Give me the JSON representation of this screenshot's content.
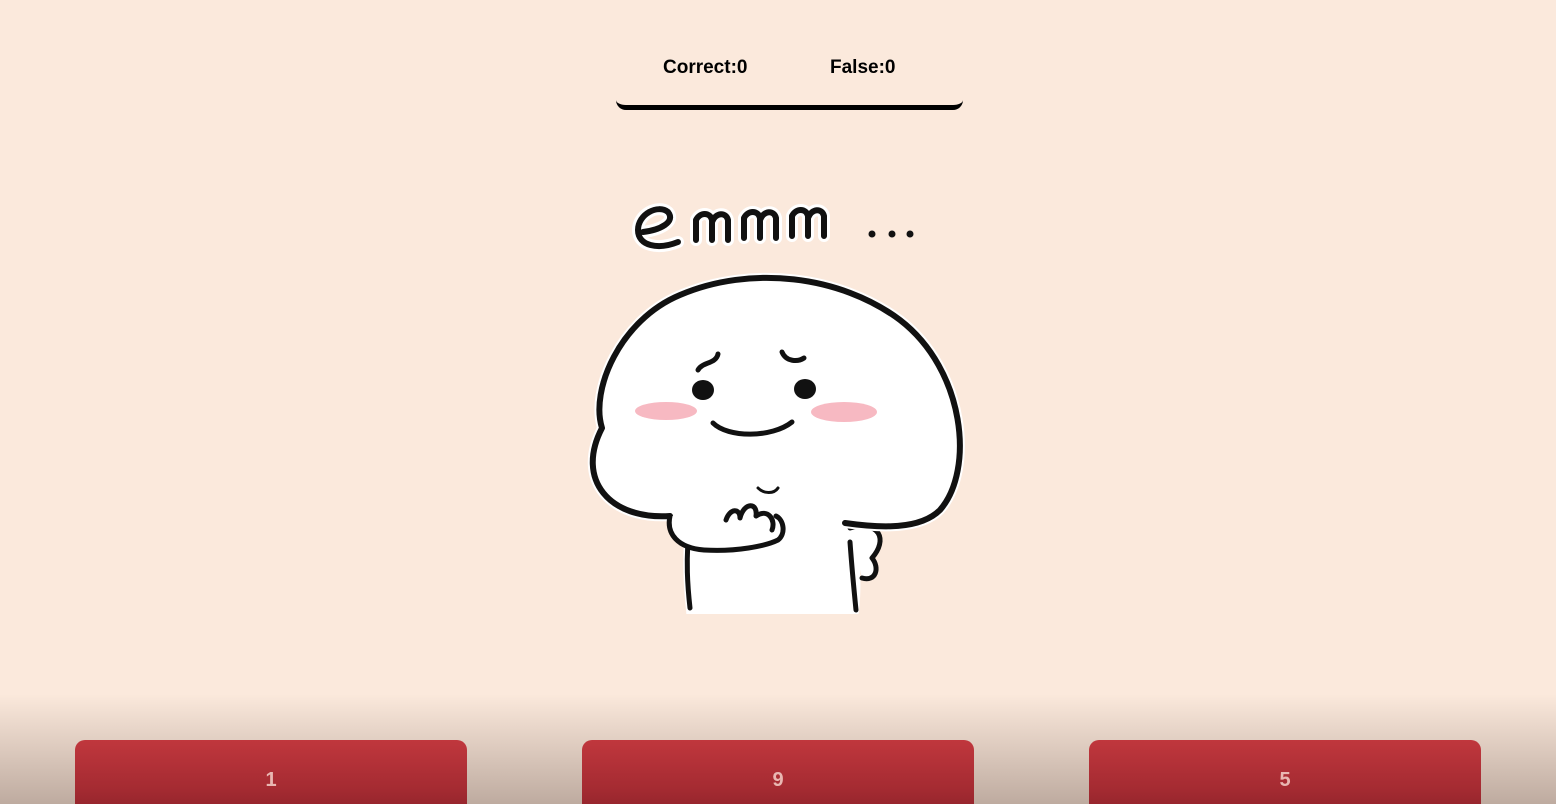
{
  "scoreboard": {
    "correct_label": "Correct:0",
    "false_label": "False:0"
  },
  "sticker": {
    "caption": "emmm...",
    "icon": "thinking-blob-character"
  },
  "answers": [
    {
      "label": "1"
    },
    {
      "label": "9"
    },
    {
      "label": "5"
    }
  ],
  "colors": {
    "background": "#fbe9dc",
    "button": "#b8323a",
    "button_text": "#e9b7b2",
    "blush": "#f7b9c2"
  }
}
